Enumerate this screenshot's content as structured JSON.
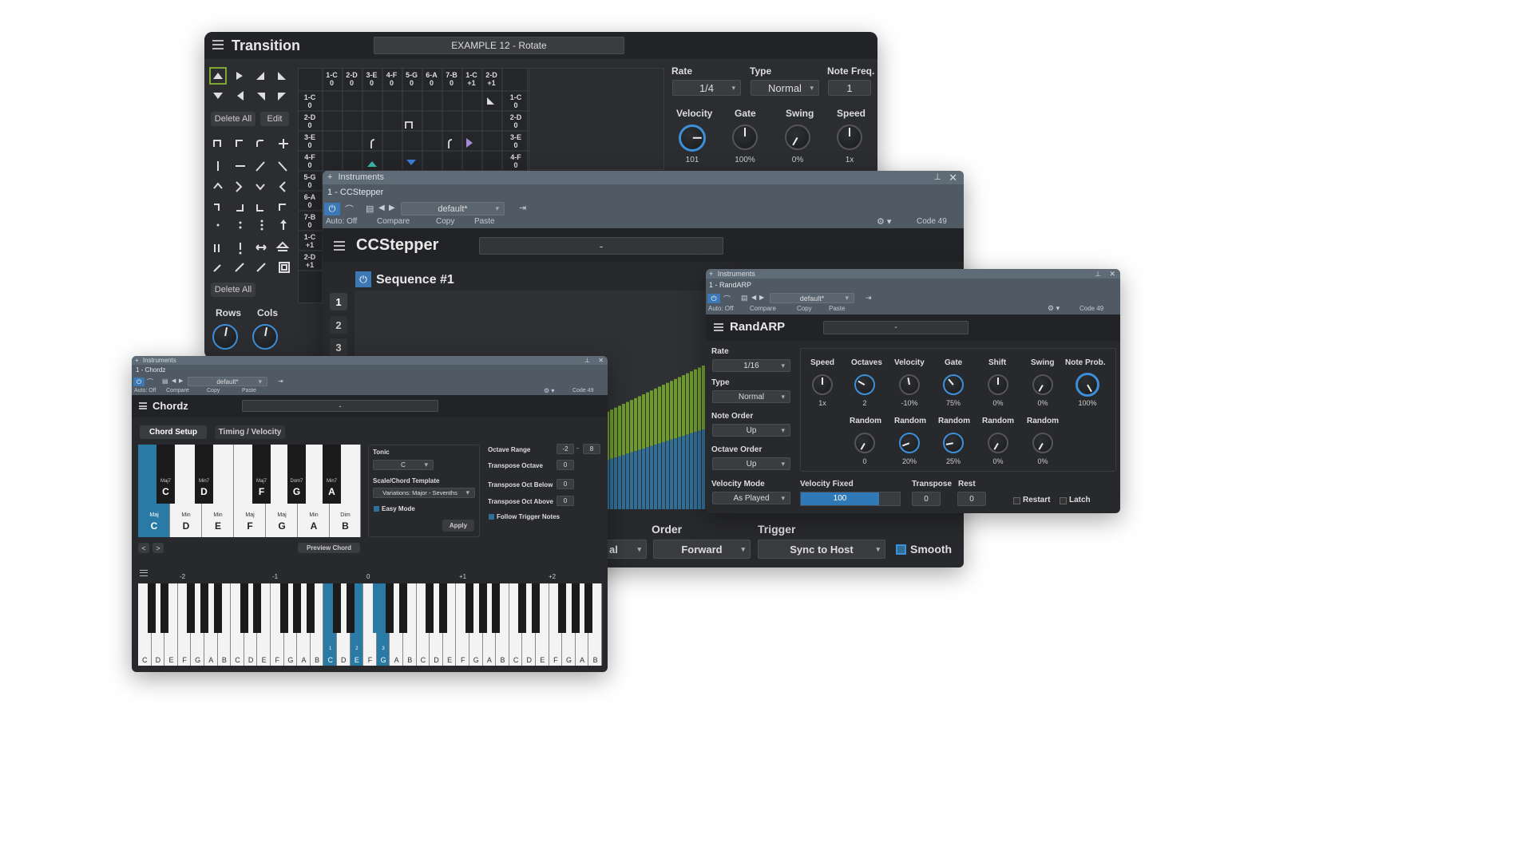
{
  "transition": {
    "title": "Transition",
    "preset": "EXAMPLE 12 - Rotate",
    "delete_all": "Delete All",
    "edit": "Edit",
    "delete_all_2": "Delete All",
    "rows_label": "Rows",
    "cols_label": "Cols",
    "col_headers": [
      [
        "1-C",
        "0"
      ],
      [
        "2-D",
        "0"
      ],
      [
        "3-E",
        "0"
      ],
      [
        "4-F",
        "0"
      ],
      [
        "5-G",
        "0"
      ],
      [
        "6-A",
        "0"
      ],
      [
        "7-B",
        "0"
      ],
      [
        "1-C",
        "+1"
      ],
      [
        "2-D",
        "+1"
      ]
    ],
    "row_headers": [
      [
        "1-C",
        "0"
      ],
      [
        "2-D",
        "0"
      ],
      [
        "3-E",
        "0"
      ],
      [
        "4-F",
        "0"
      ],
      [
        "5-G",
        "0"
      ],
      [
        "6-A",
        "0"
      ],
      [
        "7-B",
        "0"
      ],
      [
        "1-C",
        "+1"
      ],
      [
        "2-D",
        "+1"
      ]
    ],
    "right_headers": [
      [
        "1-C",
        "0"
      ],
      [
        "2-D",
        "0"
      ],
      [
        "3-E",
        "0"
      ],
      [
        "4-F",
        "0"
      ]
    ],
    "rate_label": "Rate",
    "rate_value": "1/4",
    "type_label": "Type",
    "type_value": "Normal",
    "notefreq_label": "Note Freq.",
    "notefreq_value": "1",
    "knobs": [
      {
        "label": "Velocity",
        "value": "101"
      },
      {
        "label": "Gate",
        "value": "100%"
      },
      {
        "label": "Swing",
        "value": "0%"
      },
      {
        "label": "Speed",
        "value": "1x"
      }
    ]
  },
  "ccstepper": {
    "host_title": "Instruments",
    "instance": "1 - CCStepper",
    "preset": "default*",
    "auto": "Auto: Off",
    "compare": "Compare",
    "copy": "Copy",
    "paste": "Paste",
    "code": "Code 49",
    "title": "CCStepper",
    "name_field": "-",
    "sequence": "Sequence #1",
    "seq_numbers": [
      "1",
      "2",
      "3"
    ],
    "order_label": "Order",
    "order_value": "Forward",
    "trigger_label": "Trigger",
    "trigger_value": "Sync to Host",
    "partial_value": "al",
    "smooth_label": "Smooth",
    "colors": {
      "green": "#6e9a2e",
      "blue": "#2f6f98"
    }
  },
  "randarp": {
    "host_title": "Instruments",
    "instance": "1 - RandARP",
    "preset": "default*",
    "auto": "Auto: Off",
    "compare": "Compare",
    "copy": "Copy",
    "paste": "Paste",
    "code": "Code 49",
    "title": "RandARP",
    "name_field": "-",
    "rate_label": "Rate",
    "rate_value": "1/16",
    "type_label": "Type",
    "type_value": "Normal",
    "noteorder_label": "Note Order",
    "noteorder_value": "Up",
    "octaveorder_label": "Octave Order",
    "octaveorder_value": "Up",
    "velmode_label": "Velocity Mode",
    "velmode_value": "As Played",
    "velfixed_label": "Velocity Fixed",
    "velfixed_value": "100",
    "transpose_label": "Transpose",
    "transpose_value": "0",
    "rest_label": "Rest",
    "rest_value": "0",
    "restart_label": "Restart",
    "latch_label": "Latch",
    "top_knobs": [
      {
        "label": "Speed",
        "value": "1x"
      },
      {
        "label": "Octaves",
        "value": "2"
      },
      {
        "label": "Velocity",
        "value": "-10%"
      },
      {
        "label": "Gate",
        "value": "75%"
      },
      {
        "label": "Shift",
        "value": "0%"
      },
      {
        "label": "Swing",
        "value": "0%"
      },
      {
        "label": "Note Prob.",
        "value": "100%"
      }
    ],
    "random_knobs": [
      {
        "label": "Random",
        "value": "0"
      },
      {
        "label": "Random",
        "value": "20%"
      },
      {
        "label": "Random",
        "value": "25%"
      },
      {
        "label": "Random",
        "value": "0%"
      },
      {
        "label": "Random",
        "value": "0%"
      }
    ]
  },
  "chordz": {
    "host_title": "Instruments",
    "instance": "1 - Chordz",
    "preset": "default*",
    "auto": "Auto: Off",
    "compare": "Compare",
    "copy": "Copy",
    "paste": "Paste",
    "code": "Code 49",
    "title": "Chordz",
    "name_field": "-",
    "tab1": "Chord Setup",
    "tab2": "Timing / Velocity",
    "white_keys": [
      {
        "quality": "Maj",
        "note": "C"
      },
      {
        "quality": "Min",
        "note": "D"
      },
      {
        "quality": "Min",
        "note": "E"
      },
      {
        "quality": "Maj",
        "note": "F"
      },
      {
        "quality": "Maj",
        "note": "G"
      },
      {
        "quality": "Min",
        "note": "A"
      },
      {
        "quality": "Dim",
        "note": "B"
      }
    ],
    "black_keys": [
      {
        "quality": "Maj7",
        "note": "C"
      },
      {
        "quality": "Min7",
        "note": "D"
      },
      {
        "quality": "Maj7",
        "note": "F"
      },
      {
        "quality": "Dom7",
        "note": "G"
      },
      {
        "quality": "Min7",
        "note": "A"
      }
    ],
    "tonic_label": "Tonic",
    "tonic_value": "C",
    "scale_label": "Scale/Chord Template",
    "scale_value": "Variations: Major - Sevenths",
    "easy_mode": "Easy Mode",
    "apply": "Apply",
    "octave_range_label": "Octave Range",
    "octave_range_min": "-2",
    "octave_range_sep": "-",
    "octave_range_max": "8",
    "transpose_octave_label": "Transpose Octave",
    "transpose_octave_value": "0",
    "transpose_below_label": "Transpose Oct Below",
    "transpose_below_value": "0",
    "transpose_above_label": "Transpose Oct Above",
    "transpose_above_value": "0",
    "follow_label": "Follow Trigger Notes",
    "prev": "<",
    "next": ">",
    "preview": "Preview Chord",
    "octave_marks": [
      "-2",
      "-1",
      "0",
      "+1",
      "+2"
    ],
    "keyboard_notes": [
      "C",
      "D",
      "E",
      "F",
      "G",
      "A",
      "B",
      "C",
      "D",
      "E",
      "F",
      "G",
      "A",
      "B",
      "C",
      "D",
      "E",
      "F",
      "G",
      "A",
      "B",
      "C",
      "D",
      "E",
      "F",
      "G",
      "A",
      "B",
      "C",
      "D",
      "E",
      "F",
      "G",
      "A",
      "B"
    ],
    "highlight_numbers": [
      "1",
      "2",
      "3"
    ]
  }
}
